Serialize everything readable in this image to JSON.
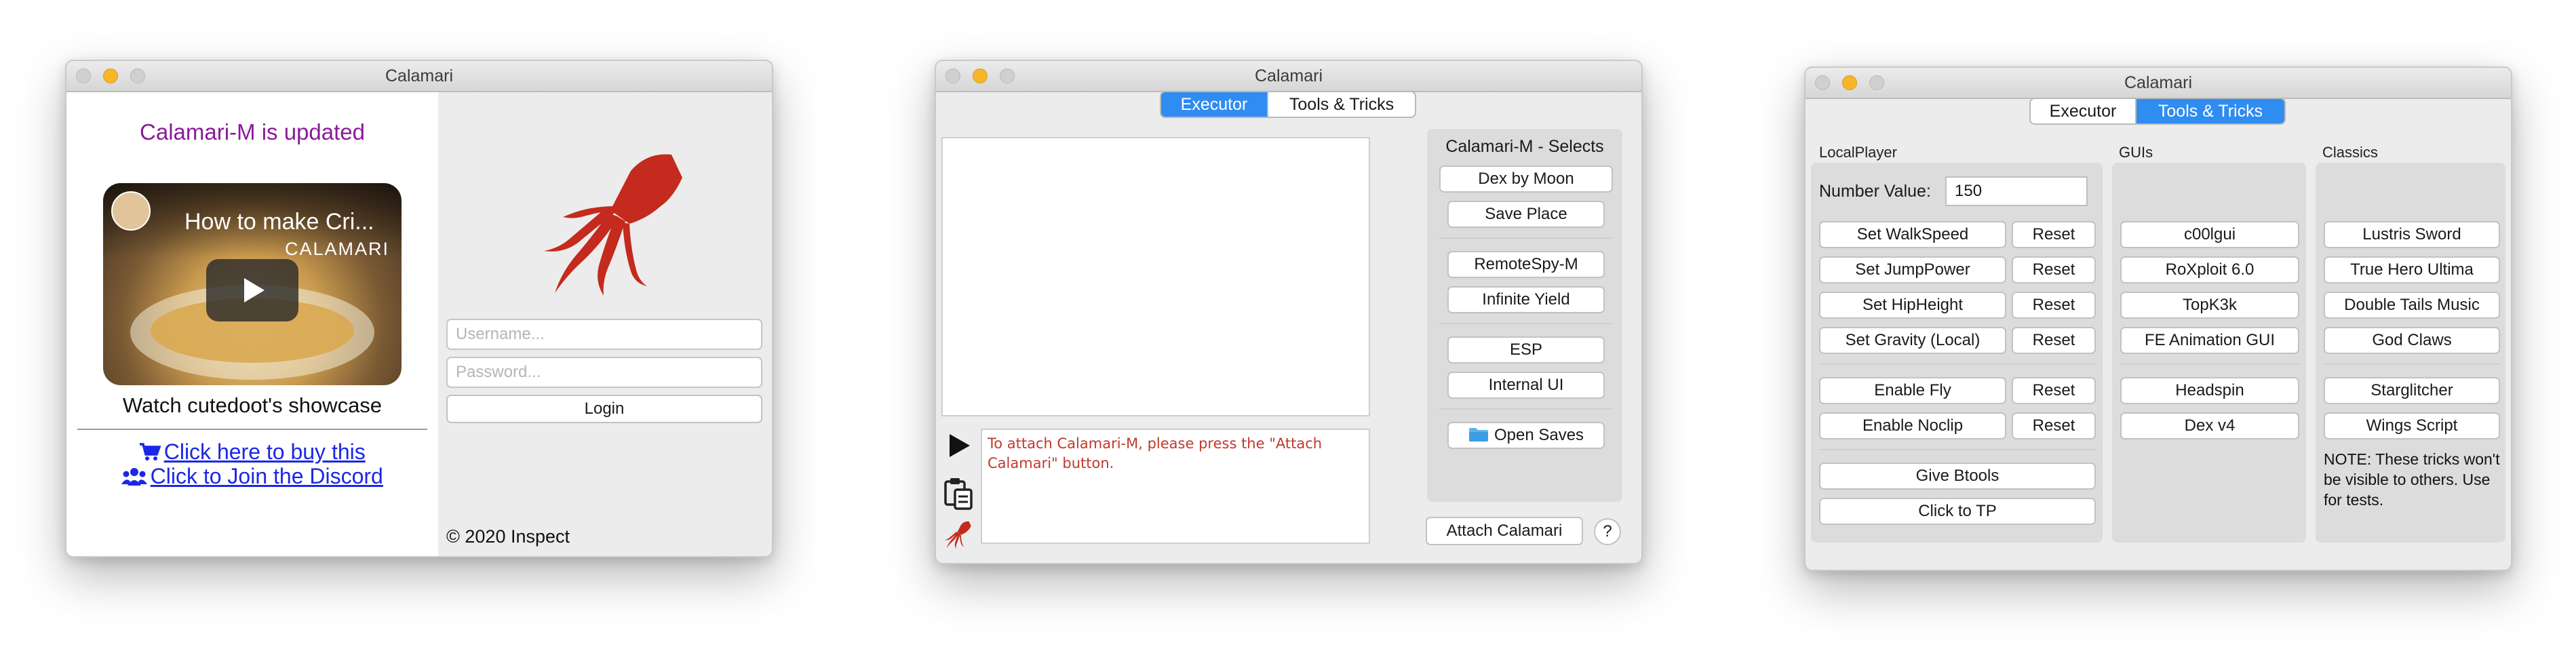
{
  "login_window": {
    "title": "Calamari",
    "update_notice": "Calamari-M is updated",
    "video": {
      "title": "How to make Cri...",
      "channel": "CALAMARI"
    },
    "showcase_caption": "Watch cutedoot's showcase",
    "buy_link": "Click here to buy this",
    "discord_link": "Click to Join the Discord",
    "username_placeholder": "Username...",
    "password_placeholder": "Password...",
    "login_label": "Login",
    "copyright": "© 2020 Inspect"
  },
  "executor_window": {
    "title": "Calamari",
    "tabs": [
      {
        "label": "Executor",
        "active": true
      },
      {
        "label": "Tools & Tricks",
        "active": false
      }
    ],
    "selects_heading": "Calamari-M - Selects",
    "select_buttons": [
      "Dex by Moon",
      "Save Place",
      "RemoteSpy-M",
      "Infinite Yield",
      "ESP",
      "Internal UI",
      "Open Saves"
    ],
    "console_message": "To attach Calamari-M, please press the \"Attach Calamari\" button.",
    "attach_label": "Attach Calamari",
    "help_label": "?"
  },
  "tools_window": {
    "title": "Calamari",
    "tabs": [
      {
        "label": "Executor",
        "active": false
      },
      {
        "label": "Tools & Tricks",
        "active": true
      }
    ],
    "localplayer": {
      "heading": "LocalPlayer",
      "number_label": "Number Value:",
      "number_value": "150",
      "rows": [
        {
          "action": "Set WalkSpeed",
          "reset": "Reset"
        },
        {
          "action": "Set JumpPower",
          "reset": "Reset"
        },
        {
          "action": "Set HipHeight",
          "reset": "Reset"
        },
        {
          "action": "Set Gravity (Local)",
          "reset": "Reset"
        },
        {
          "action": "Enable Fly",
          "reset": "Reset"
        },
        {
          "action": "Enable Noclip",
          "reset": "Reset"
        }
      ],
      "give_btools": "Give Btools",
      "click_tp": "Click to TP"
    },
    "guis": {
      "heading": "GUIs",
      "items": [
        "c00lgui",
        "RoXploit 6.0",
        "TopK3k",
        "FE Animation GUI",
        "Headspin",
        "Dex v4"
      ]
    },
    "classics": {
      "heading": "Classics",
      "items": [
        "Lustris Sword",
        "True Hero Ultima",
        "Double Tails Music",
        "God Claws",
        "Starglitcher",
        "Wings Script"
      ],
      "note": "NOTE: These tricks won't be visible to others. Use for tests."
    }
  },
  "colors": {
    "tab_active": "#2f8cf0",
    "squid": "#c42a1d",
    "update_text": "#8a1a9a",
    "link": "#1b27e6",
    "console_text": "#c0392b"
  },
  "icons": [
    "cart-icon",
    "users-icon",
    "play-icon",
    "clipboard-icon",
    "squid-icon",
    "folder-icon"
  ]
}
